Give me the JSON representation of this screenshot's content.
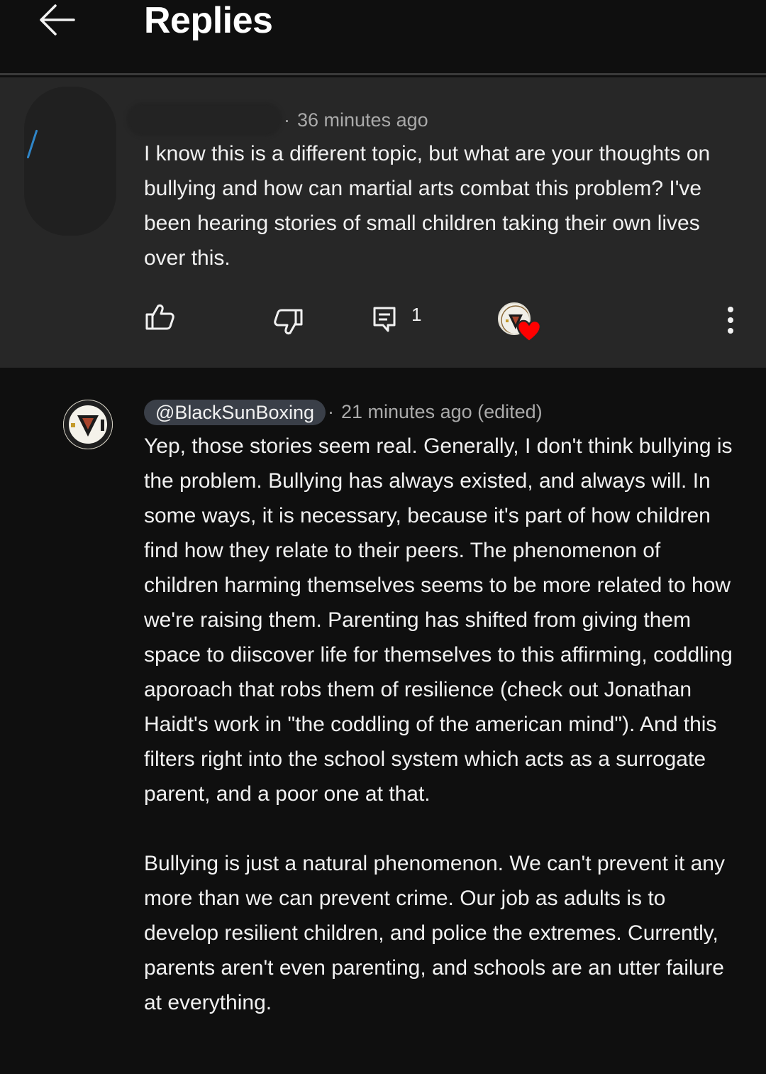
{
  "header": {
    "title": "Replies",
    "back_icon": "arrow-left-icon"
  },
  "parent_comment": {
    "timestamp": "36 minutes ago",
    "separator": "·",
    "text": "I know this is a different topic, but what are your thoughts on bullying and how can martial arts combat this problem?  I've been hearing stories of small children taking their own lives over this.",
    "reply_count": "1",
    "actions": {
      "like_icon": "thumbs-up-icon",
      "dislike_icon": "thumbs-down-icon",
      "reply_icon": "comment-icon",
      "more_icon": "more-vertical-icon"
    },
    "creator_heart_color": "#ff0000"
  },
  "reply": {
    "author": "@BlackSunBoxing",
    "separator": "·",
    "timestamp": "21 minutes ago (edited)",
    "paragraphs": [
      "Yep, those stories seem real. Generally, I don't think bullying is the problem. Bullying has always existed, and always will. In some ways, it is necessary, because it's part of how children find how they relate to their peers. The phenomenon of children harming themselves seems to be more related to how we're raising them. Parenting has shifted from giving them space to diiscover life for themselves to this affirming, coddling aporoach that robs them of resilience (check out Jonathan Haidt's work in \"the coddling of the american mind\").  And this filters right into the school system which acts as a surrogate parent, and a poor one at that.",
      "Bullying is just a natural phenomenon. We can't prevent it any more than we can prevent crime. Our job as adults is to develop resilient children, and police the extremes. Currently, parents aren't even parenting, and schools are an utter failure at everything."
    ]
  },
  "colors": {
    "background": "#0f0f0f",
    "parent_background": "#272727",
    "text_primary": "#f1f1f1",
    "text_secondary": "#aaaaaa",
    "handle_chip": "#3a3f48"
  }
}
